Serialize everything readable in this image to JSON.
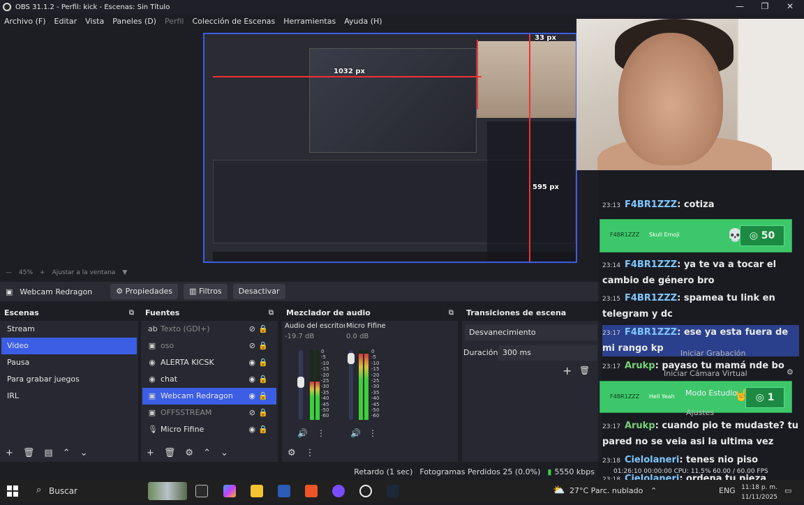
{
  "window": {
    "title": "OBS 31.1.2 - Perfil: kick - Escenas: Sin Título",
    "minimize": "—",
    "restore": "❐",
    "close": "✕"
  },
  "menu": {
    "file": "Archivo (F)",
    "edit": "Editar",
    "view": "Vista",
    "docks": "Paneles (D)",
    "profile": "Perfil",
    "scene_collection": "Colección de Escenas",
    "tools": "Herramientas",
    "help": "Ayuda (H)"
  },
  "preview": {
    "dim_1032": "1032 px",
    "dim_33": "33 px",
    "dim_595": "595 px"
  },
  "zoom": {
    "minus": "—",
    "value": "45%",
    "plus": "+",
    "fit": "Ajustar a la ventana",
    "arrow": "▼"
  },
  "source_toolbar": {
    "source_name": "Webcam Redragon",
    "properties": "Propiedades",
    "filters": "Filtros",
    "deactivate": "Desactivar"
  },
  "scenes": {
    "title": "Escenas",
    "items": [
      {
        "label": "Stream"
      },
      {
        "label": "Video"
      },
      {
        "label": "Pausa"
      },
      {
        "label": "Para grabar juegos"
      },
      {
        "label": "IRL"
      }
    ],
    "selected_index": 1
  },
  "sources": {
    "title": "Fuentes",
    "items": [
      {
        "label": "Texto (GDI+)"
      },
      {
        "label": "oso"
      },
      {
        "label": "ALERTA KICSK"
      },
      {
        "label": "chat"
      },
      {
        "label": "Webcam Redragon"
      },
      {
        "label": "OFFSSTREAM"
      },
      {
        "label": "Micro Fifine"
      }
    ],
    "selected_index": 4
  },
  "mixer": {
    "title": "Mezclador de audio",
    "channels": [
      {
        "name": "Audio del escritorio",
        "db": "-19.7 dB",
        "level": 0.55
      },
      {
        "name": "Micro Fifine",
        "db": "0.0 dB",
        "level": 0.95
      }
    ],
    "scale": [
      "0",
      "-5",
      "-10",
      "-15",
      "-20",
      "-25",
      "-30",
      "-35",
      "-40",
      "-45",
      "-50",
      "-60"
    ]
  },
  "transitions": {
    "title": "Transiciones de escena",
    "current": "Desvanecimiento",
    "duration_label": "Duración",
    "duration_value": "300 ms"
  },
  "controls_ghost": {
    "start_recording": "Iniciar Grabación",
    "start_virtual_cam": "Iniciar Cámara Virtual",
    "studio_mode": "Modo Estudio",
    "settings": "Ajustes"
  },
  "chat": {
    "messages": [
      {
        "time": "23:13",
        "user": "F4BR1ZZZ",
        "text": ": cotiza"
      },
      {
        "time": "23:14",
        "user": "F4BR1ZZZ",
        "text": ": ya te va a tocar el cambio de género bro"
      },
      {
        "time": "23:15",
        "user": "F4BR1ZZZ",
        "text": ": spamea tu link en telegram y dc"
      },
      {
        "time": "23:17",
        "user": "F4BR1ZZZ",
        "text": ": ese ya esta fuera de mi rango kp"
      },
      {
        "time": "23:17",
        "user": "Arukp",
        "text": ": payaso tu mamá nde bo"
      },
      {
        "time": "23:17",
        "user": "Arukp",
        "text": ": cuando pio te mudaste? tu pared no se veia asi la ultima vez"
      },
      {
        "time": "23:18",
        "user": "Cielolaneri",
        "text": ": tenes nio piso"
      },
      {
        "time": "23:18",
        "user": "Cielolaneri",
        "text": ": ordena tu pieza"
      }
    ],
    "gifts": [
      {
        "user": "F4BR1ZZZ",
        "item": "Skull Emoji",
        "amount": "50"
      },
      {
        "user": "F4BR1ZZZ",
        "item": "Hell Yeah",
        "amount": "1"
      }
    ]
  },
  "status": {
    "delay": "Retardo (1 sec)",
    "dropped": "Fotogramas Perdidos 25 (0.0%)",
    "bitrate": "5550 kbps",
    "rec_time": "01:26:10",
    "rec2": "00:00:00",
    "cpu": "CPU: 11.5%",
    "fps": "60.00 / 60.00 FPS"
  },
  "taskbar": {
    "search": "Buscar",
    "weather": "27°C  Parc. nublado",
    "lang": "ENG",
    "time": "11:18 p. m.",
    "date": "11/11/2025"
  },
  "colors": {
    "accent": "#3b5ee5",
    "meter_green": "#3ad13a",
    "gift_green": "#3ec76a",
    "guide_red": "#e33333"
  }
}
